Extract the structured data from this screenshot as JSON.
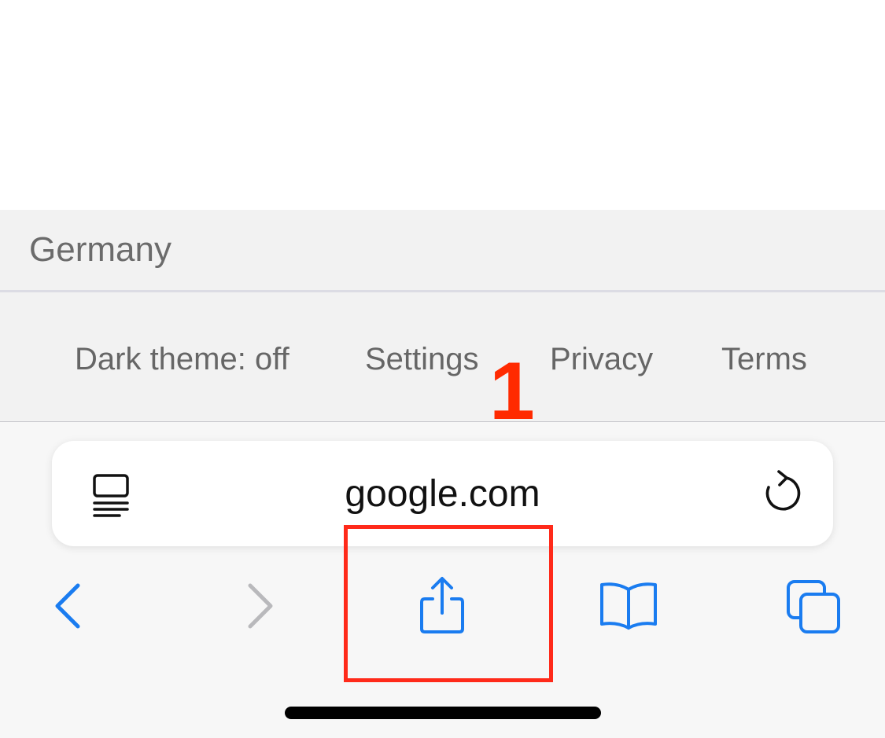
{
  "footer": {
    "country": "Germany",
    "links": [
      {
        "label": "Dark theme: off"
      },
      {
        "label": "Settings"
      },
      {
        "label": "Privacy"
      },
      {
        "label": "Terms"
      }
    ]
  },
  "address_bar": {
    "url": "google.com",
    "left_icon": "reader-mode-icon",
    "right_icon": "reload-icon"
  },
  "toolbar": {
    "buttons": [
      {
        "icon": "back-chevron-icon",
        "enabled": true
      },
      {
        "icon": "forward-chevron-icon",
        "enabled": false
      },
      {
        "icon": "share-icon",
        "enabled": true
      },
      {
        "icon": "bookmarks-book-icon",
        "enabled": true
      },
      {
        "icon": "tabs-icon",
        "enabled": true
      }
    ]
  },
  "annotation": {
    "step_number": "1",
    "color": "#ff2a00"
  },
  "colors": {
    "accent": "#1a7cf0",
    "disabled": "#b9b9bc",
    "footer_bg": "#f2f2f2",
    "toolbar_bg": "#f7f7f7"
  }
}
